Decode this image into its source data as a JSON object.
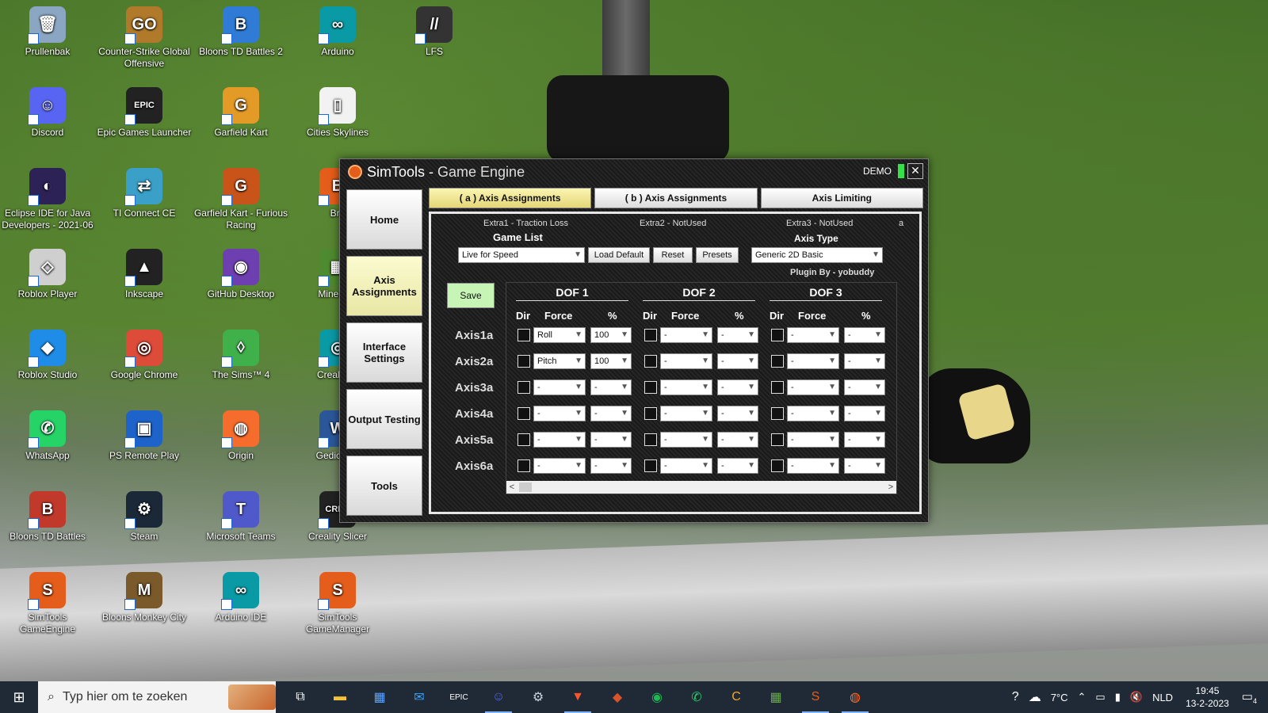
{
  "desktop_icons": [
    {
      "label": "Prullenbak",
      "color": "#8aa6c2",
      "glyph": "🗑"
    },
    {
      "label": "Counter-Strike Global Offensive",
      "color": "#b07a2a",
      "glyph": "GO"
    },
    {
      "label": "Bloons TD Battles 2",
      "color": "#2f7bd6",
      "glyph": "B"
    },
    {
      "label": "Arduino",
      "color": "#0a9aa5",
      "glyph": "∞"
    },
    {
      "label": "LFS",
      "color": "#333333",
      "glyph": "//"
    },
    {
      "label": "Discord",
      "color": "#5865f2",
      "glyph": "☺"
    },
    {
      "label": "Epic Games Launcher",
      "color": "#222222",
      "glyph": "EPIC"
    },
    {
      "label": "Garfield Kart",
      "color": "#e39a26",
      "glyph": "G"
    },
    {
      "label": "Cities Skylines",
      "color": "#f2f2f2",
      "glyph": "▯"
    },
    {
      "label": "Eclipse IDE for Java Developers - 2021-06",
      "color": "#2c2255",
      "glyph": "◐"
    },
    {
      "label": "TI Connect CE",
      "color": "#3aa0c8",
      "glyph": "⇄"
    },
    {
      "label": "Garfield Kart - Furious Racing",
      "color": "#c9541a",
      "glyph": "G"
    },
    {
      "label": "Roblox Player",
      "color": "#cfcfcf",
      "glyph": "◇"
    },
    {
      "label": "Inkscape",
      "color": "#222222",
      "glyph": "▲"
    },
    {
      "label": "GitHub Desktop",
      "color": "#6e3fb0",
      "glyph": "◉"
    },
    {
      "label": "Roblox Studio",
      "color": "#1f8ce8",
      "glyph": "◆"
    },
    {
      "label": "Google Chrome",
      "color": "#dd4b39",
      "glyph": "◎"
    },
    {
      "label": "The Sims™ 4",
      "color": "#3fb04a",
      "glyph": "◊"
    },
    {
      "label": "WhatsApp",
      "color": "#25d366",
      "glyph": "✆"
    },
    {
      "label": "PS Remote Play",
      "color": "#1d63c9",
      "glyph": "▣"
    },
    {
      "label": "Origin",
      "color": "#f56c2d",
      "glyph": "◍"
    },
    {
      "label": "Bloons TD Battles",
      "color": "#c0392b",
      "glyph": "B"
    },
    {
      "label": "Steam",
      "color": "#1b2838",
      "glyph": "⚙"
    },
    {
      "label": "Microsoft Teams",
      "color": "#5059c9",
      "glyph": "T"
    },
    {
      "label": "Creality Slicer",
      "color": "#222222",
      "glyph": "CREA"
    },
    {
      "label": "SimTools GameEngine",
      "color": "#e55d1a",
      "glyph": "S"
    },
    {
      "label": "Bloons Monkey City",
      "color": "#7a5a2a",
      "glyph": "M"
    },
    {
      "label": "Arduino IDE",
      "color": "#0a9aa5",
      "glyph": "∞"
    },
    {
      "label": "SimTools GameManager",
      "color": "#e55d1a",
      "glyph": "S"
    }
  ],
  "partial_icons": [
    {
      "label": "Bra",
      "color": "#e55d1a",
      "glyph": "B"
    },
    {
      "label": "Minecraft",
      "color": "#4e8a2f",
      "glyph": "▦"
    },
    {
      "label": "Creality S",
      "color": "#0a9aa5",
      "glyph": "◎"
    },
    {
      "label": "Gedicht M",
      "color": "#2b579a",
      "glyph": "W"
    }
  ],
  "window": {
    "title_a": "SimTools - ",
    "title_b": "Game Engine",
    "demo": "DEMO",
    "close": "✕"
  },
  "sidebar": [
    "Home",
    "Axis Assignments",
    "Interface Settings",
    "Output Testing",
    "Tools"
  ],
  "tabs": [
    "( a ) Axis Assignments",
    "( b ) Axis Assignments",
    "Axis Limiting"
  ],
  "extras": {
    "e1": "Extra1 - Traction Loss",
    "e2": "Extra2 - NotUsed",
    "e3": "Extra3 - NotUsed",
    "corner": "a"
  },
  "game_list": {
    "label": "Game List",
    "value": "Live for Speed"
  },
  "buttons": {
    "load_default": "Load Default",
    "reset": "Reset",
    "presets": "Presets",
    "save": "Save"
  },
  "axis_type": {
    "label": "Axis Type",
    "value": "Generic 2D Basic"
  },
  "plugin": "Plugin By - yobuddy",
  "dofs": [
    "DOF 1",
    "DOF 2",
    "DOF 3"
  ],
  "col_headers": {
    "dir": "Dir",
    "force": "Force",
    "pct": "%"
  },
  "axes": [
    {
      "name": "Axis1a",
      "cells": [
        [
          "Roll",
          "100"
        ],
        [
          "-",
          "-"
        ],
        [
          "-",
          "-"
        ]
      ]
    },
    {
      "name": "Axis2a",
      "cells": [
        [
          "Pitch",
          "100"
        ],
        [
          "-",
          "-"
        ],
        [
          "-",
          "-"
        ]
      ]
    },
    {
      "name": "Axis3a",
      "cells": [
        [
          "-",
          "-"
        ],
        [
          "-",
          "-"
        ],
        [
          "-",
          "-"
        ]
      ]
    },
    {
      "name": "Axis4a",
      "cells": [
        [
          "-",
          "-"
        ],
        [
          "-",
          "-"
        ],
        [
          "-",
          "-"
        ]
      ]
    },
    {
      "name": "Axis5a",
      "cells": [
        [
          "-",
          "-"
        ],
        [
          "-",
          "-"
        ],
        [
          "-",
          "-"
        ]
      ]
    },
    {
      "name": "Axis6a",
      "cells": [
        [
          "-",
          "-"
        ],
        [
          "-",
          "-"
        ],
        [
          "-",
          "-"
        ]
      ]
    }
  ],
  "taskbar": {
    "search_placeholder": "Typ hier om te zoeken",
    "apps": [
      {
        "name": "task-view",
        "glyph": "⧉",
        "color": "#ffffff"
      },
      {
        "name": "file-explorer",
        "glyph": "▬",
        "color": "#f3c13a"
      },
      {
        "name": "store",
        "glyph": "▦",
        "color": "#5aa3ff"
      },
      {
        "name": "mail",
        "glyph": "✉",
        "color": "#3aa0ff"
      },
      {
        "name": "epic-games",
        "glyph": "EPIC",
        "color": "#ffffff"
      },
      {
        "name": "discord",
        "glyph": "☺",
        "color": "#5865f2"
      },
      {
        "name": "steam",
        "glyph": "⚙",
        "color": "#c7d5e0"
      },
      {
        "name": "brave",
        "glyph": "▼",
        "color": "#fb542b"
      },
      {
        "name": "csgo",
        "glyph": "◆",
        "color": "#d9542b"
      },
      {
        "name": "spotify",
        "glyph": "◉",
        "color": "#1db954"
      },
      {
        "name": "whatsapp",
        "glyph": "✆",
        "color": "#25d366"
      },
      {
        "name": "c-app",
        "glyph": "C",
        "color": "#f5a623"
      },
      {
        "name": "minecraft",
        "glyph": "▦",
        "color": "#6aa84f"
      },
      {
        "name": "simtools",
        "glyph": "S",
        "color": "#e55d1a"
      },
      {
        "name": "origin",
        "glyph": "◍",
        "color": "#f56c2d"
      }
    ],
    "weather": "7°C",
    "lang": "NLD",
    "time": "19:45",
    "date": "13-2-2023",
    "notif_count": "4"
  }
}
